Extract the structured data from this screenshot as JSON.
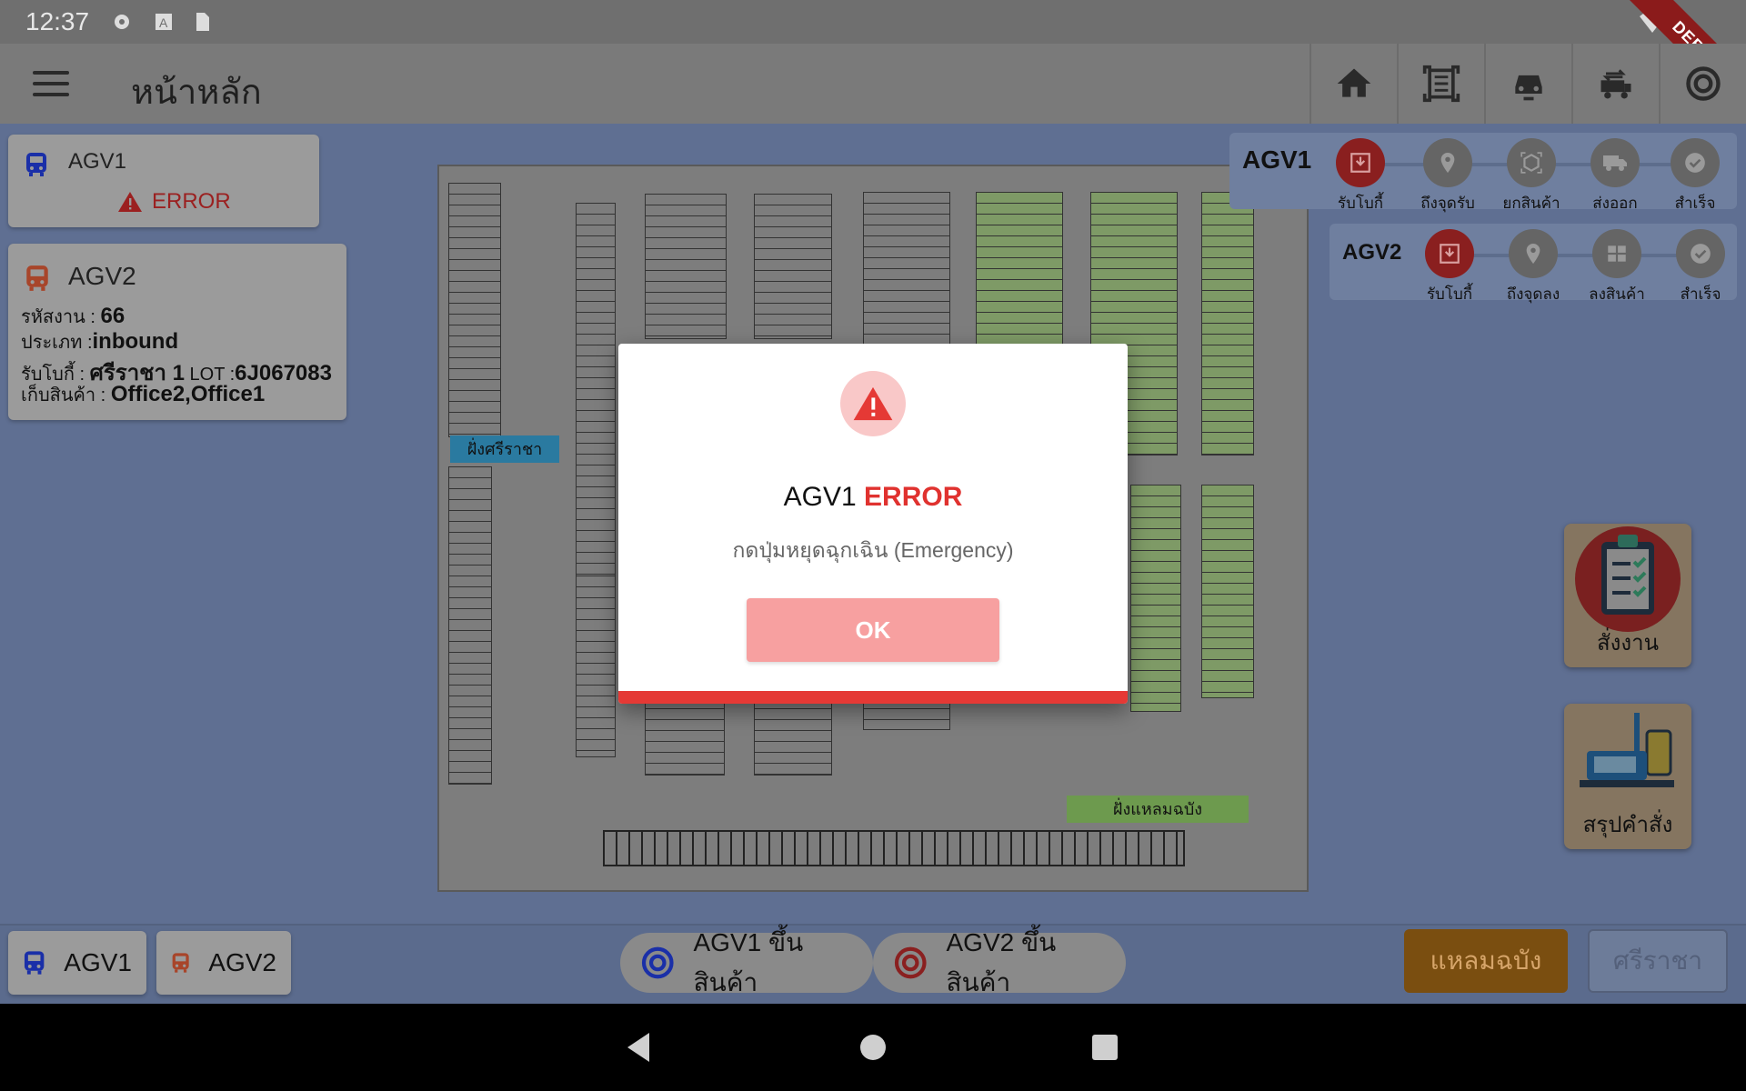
{
  "status_bar": {
    "time": "12:37",
    "debug_label": "DEBUG"
  },
  "app_bar": {
    "title": "หน้าหลัก"
  },
  "agv1_card": {
    "name": "AGV1",
    "status": "ERROR"
  },
  "agv2_card": {
    "name": "AGV2",
    "job_label": "รหัสงาน :",
    "job_value": "66",
    "type_label": "ประเภท :",
    "type_value": "inbound",
    "pickup_label": "รับโบกี้ :",
    "pickup_value": "ศรีราชา 1",
    "lot_label": "LOT :",
    "lot_value": "6J067083",
    "store_label": "เก็บสินค้า  :",
    "store_value": "Office2,Office1"
  },
  "map": {
    "left_zone_label": "ฝั่งศรีราชา",
    "bottom_zone_label": "ฝั่งแหลมฉบัง"
  },
  "stepper_agv1": {
    "title": "AGV1",
    "steps": [
      "รับโบกี้",
      "ถึงจุดรับ",
      "ยกสินค้า",
      "ส่งออก",
      "สำเร็จ"
    ]
  },
  "stepper_agv2": {
    "title": "AGV2",
    "steps": [
      "รับโบกี้",
      "ถึงจุดลง",
      "ลงสินค้า",
      "สำเร็จ"
    ]
  },
  "side_actions": {
    "assign_label": "สั่งงาน",
    "summary_label": "สรุปคำสั่ง"
  },
  "bottom_bar": {
    "agv1_label": "AGV1",
    "agv2_label": "AGV2",
    "agv1_load_label": "AGV1 ขึ้นสินค้า",
    "agv2_load_label": "AGV2 ขึ้นสินค้า",
    "site_a_label": "แหลมฉบัง",
    "site_b_label": "ศรีราชา"
  },
  "dialog": {
    "title_prefix": "AGV1 ",
    "title_status": "ERROR",
    "message": "กดปุ่มหยุดฉุกเฉิน (Emergency)",
    "ok_label": "OK"
  },
  "colors": {
    "error_red": "#e53935",
    "ok_button": "#f7a0a0",
    "agv1_blue": "#1a2fa8",
    "agv2_orange": "#e0502a",
    "site_a_orange": "#f59e0b"
  }
}
